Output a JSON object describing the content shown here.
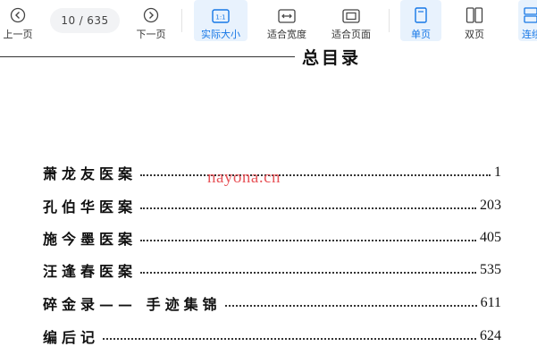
{
  "toolbar": {
    "prev_label": "上一页",
    "page_current": "10",
    "page_sep": "/",
    "page_total": "635",
    "next_label": "下一页",
    "actual_size_label": "实际大小",
    "fit_width_label": "适合宽度",
    "fit_page_label": "适合页面",
    "single_page_label": "单页",
    "double_page_label": "双页",
    "continuous_label": "连续",
    "accent_color": "#1677e6"
  },
  "document": {
    "heading": "总目录",
    "toc": [
      {
        "title": "萧龙友医案",
        "page": "1"
      },
      {
        "title": "孔伯华医案",
        "page": "203"
      },
      {
        "title": "施今墨医案",
        "page": "405"
      },
      {
        "title": "汪逢春医案",
        "page": "535"
      },
      {
        "title": "碎金录—— 手迹集锦",
        "page": "611"
      },
      {
        "title": "编后记",
        "page": "624"
      }
    ],
    "watermark": "nayona.cn"
  }
}
